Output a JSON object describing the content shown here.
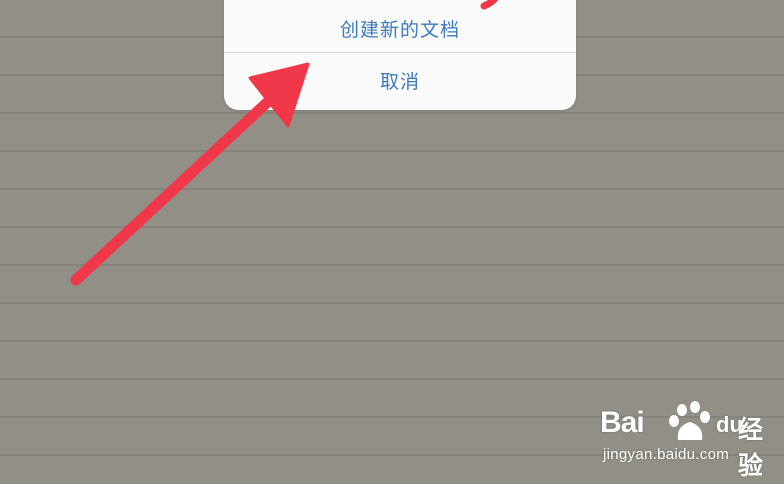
{
  "action_sheet": {
    "create_label": "创建新的文档",
    "cancel_label": "取消",
    "accent_color": "#3d7bbd"
  },
  "annotation": {
    "icon": "arrow-icon",
    "color": "#f0384a"
  },
  "watermark": {
    "brand": "Bai",
    "brand_suffix": "du",
    "product": "经验",
    "url": "jingyan.baidu.com"
  }
}
